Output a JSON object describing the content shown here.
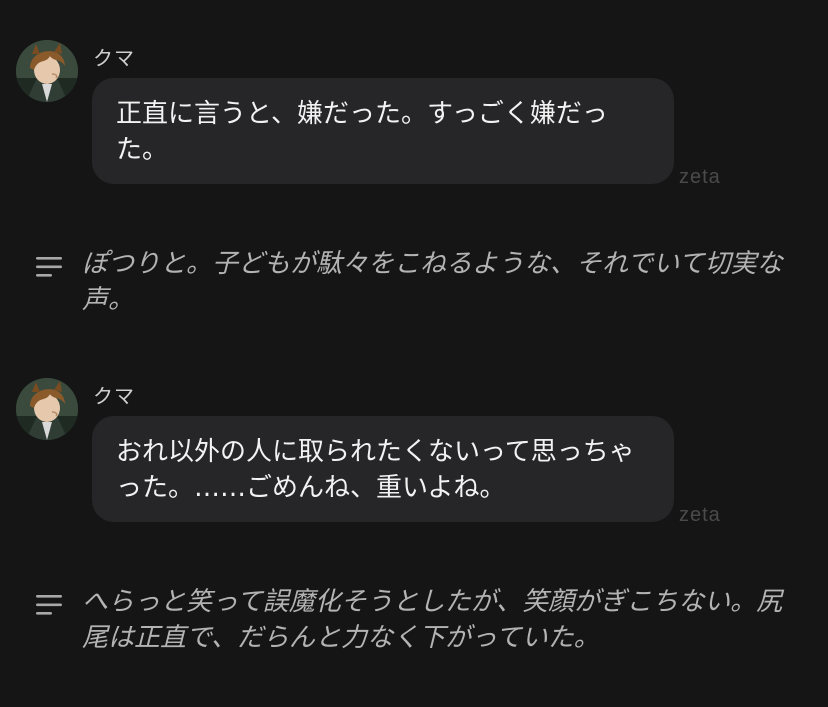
{
  "messages": [
    {
      "sender": "クマ",
      "text": "正直に言うと、嫌だった。すっごく嫌だった。",
      "watermark": "zeta"
    },
    {
      "sender": "クマ",
      "text": "おれ以外の人に取られたくないって思っちゃった。……ごめんね、重いよね。",
      "watermark": "zeta"
    }
  ],
  "narrations": [
    {
      "icon": "narration-lines-icon",
      "text": "ぽつりと。子どもが駄々をこねるような、それでいて切実な声。"
    },
    {
      "icon": "narration-lines-icon",
      "text": "へらっと笑って誤魔化そうとしたが、笑顔がぎこちない。尻尾は正直で、だらんと力なく下がっていた。"
    }
  ],
  "colors": {
    "background": "#151515",
    "bubble": "#262628",
    "narration_text": "#b3b3b3",
    "watermark": "#4a4a4a"
  }
}
